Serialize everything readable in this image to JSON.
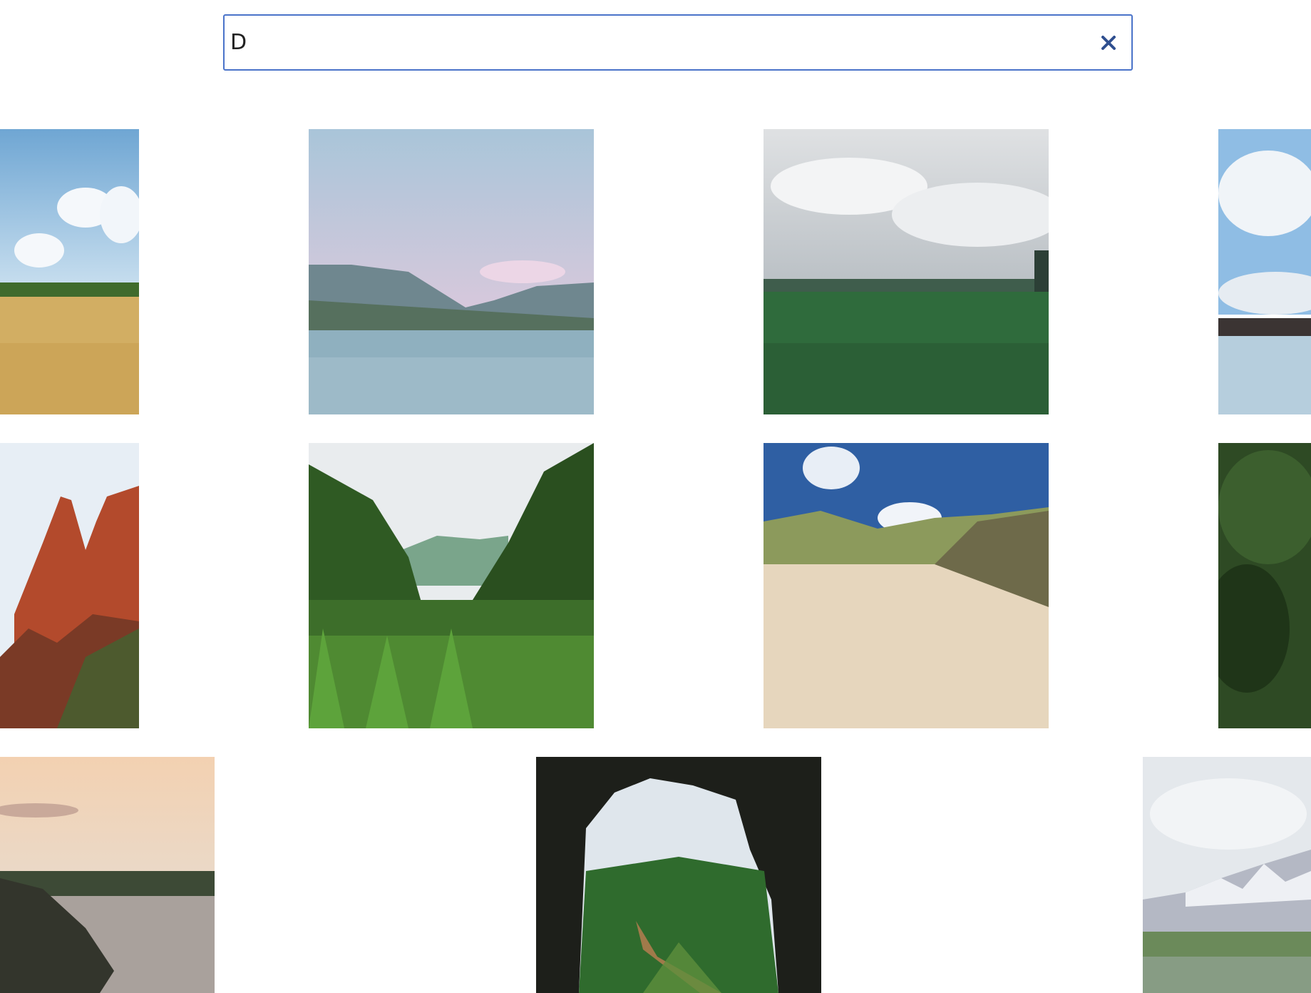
{
  "search": {
    "value": "D",
    "placeholder": "",
    "clear_icon": "close-icon",
    "border_color": "#4a73c9",
    "icon_color": "#2f4f8f"
  },
  "gallery": {
    "images": [
      {
        "id": "wheat-field-sky"
      },
      {
        "id": "lake-mountains-pastel"
      },
      {
        "id": "green-meadow-cloudy"
      },
      {
        "id": "glacier-lagoon"
      },
      {
        "id": "red-rock-spires"
      },
      {
        "id": "green-valley-grass"
      },
      {
        "id": "sand-dunes-blue-sky"
      },
      {
        "id": "dark-forest"
      },
      {
        "id": "coastline-sunset"
      },
      {
        "id": "cave-view-valley"
      },
      {
        "id": "snowy-mountains-meadow"
      }
    ]
  }
}
